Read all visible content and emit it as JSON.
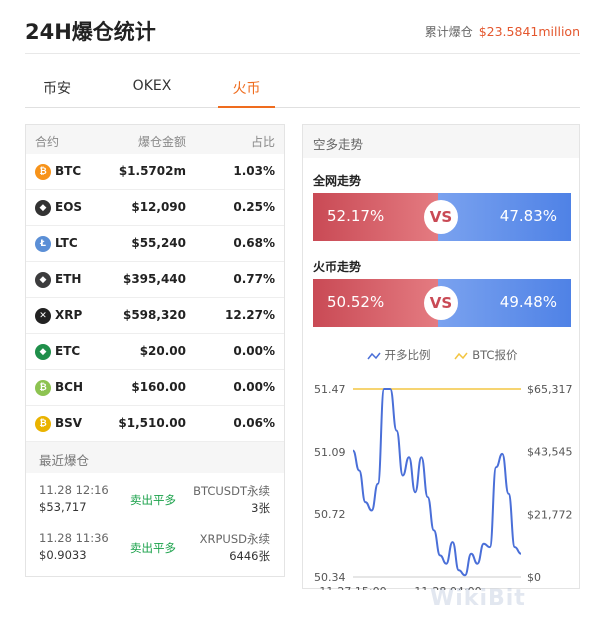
{
  "header": {
    "title": "24H爆仓统计",
    "total_label": "累计爆仓",
    "total_value": "$23.5841million"
  },
  "tabs": [
    {
      "label": "币安"
    },
    {
      "label": "OKEX"
    },
    {
      "label": "火币"
    }
  ],
  "active_tab": "火币",
  "table": {
    "columns": [
      "合约",
      "爆仓金额",
      "占比"
    ],
    "rows": [
      {
        "coin": "BTC",
        "amount": "$1.5702m",
        "ratio": "1.03%",
        "icon": "bitcoin-icon",
        "color": "#f7931a",
        "glyph": "₿"
      },
      {
        "coin": "EOS",
        "amount": "$12,090",
        "ratio": "0.25%",
        "icon": "eos-icon",
        "color": "#333333",
        "glyph": "◆"
      },
      {
        "coin": "LTC",
        "amount": "$55,240",
        "ratio": "0.68%",
        "icon": "litecoin-icon",
        "color": "#5b8fd6",
        "glyph": "Ł"
      },
      {
        "coin": "ETH",
        "amount": "$395,440",
        "ratio": "0.77%",
        "icon": "ethereum-icon",
        "color": "#3c3c3d",
        "glyph": "◆"
      },
      {
        "coin": "XRP",
        "amount": "$598,320",
        "ratio": "12.27%",
        "icon": "xrp-icon",
        "color": "#222222",
        "glyph": "✕"
      },
      {
        "coin": "ETC",
        "amount": "$20.00",
        "ratio": "0.00%",
        "icon": "ethereum-classic-icon",
        "color": "#1f8f4a",
        "glyph": "◆"
      },
      {
        "coin": "BCH",
        "amount": "$160.00",
        "ratio": "0.00%",
        "icon": "bitcoin-cash-icon",
        "color": "#8dc351",
        "glyph": "₿"
      },
      {
        "coin": "BSV",
        "amount": "$1,510.00",
        "ratio": "0.06%",
        "icon": "bitcoin-sv-icon",
        "color": "#eab300",
        "glyph": "₿"
      }
    ]
  },
  "recent": {
    "title": "最近爆仓",
    "items": [
      {
        "time": "11.28 12:16",
        "price": "$53,717",
        "action": "卖出平多",
        "pair": "BTCUSDT永续",
        "qty": "3张"
      },
      {
        "time": "11.28 11:36",
        "price": "$0.9033",
        "action": "卖出平多",
        "pair": "XRPUSD永续",
        "qty": "6446张"
      }
    ]
  },
  "trend": {
    "title": "空多走势",
    "network": {
      "label": "全网走势",
      "long": "52.17%",
      "short": "47.83%",
      "vs": "VS"
    },
    "huobi": {
      "label": "火币走势",
      "long": "50.52%",
      "short": "49.48%",
      "vs": "VS"
    }
  },
  "colors": {
    "accent": "#ef6c1e",
    "long": "#c94a55",
    "short": "#4f82e6",
    "ratio_line": "#4a6fd8",
    "btc_line": "#f3c542",
    "green": "#1aa14a"
  },
  "chart_data": {
    "type": "line",
    "legend": [
      "开多比例",
      "BTC报价"
    ],
    "left_axis": {
      "ticks": [
        "51.47",
        "51.09",
        "50.72",
        "50.34"
      ],
      "ylim": [
        50.34,
        51.47
      ]
    },
    "right_axis": {
      "ticks": [
        "$65,317",
        "$43,545",
        "$21,772",
        "$0"
      ],
      "ylim": [
        0,
        65317
      ]
    },
    "x_ticks": [
      "11-27 15:00",
      "11-28 04:00"
    ],
    "series": [
      {
        "name": "开多比例",
        "values": [
          51.1,
          50.98,
          50.79,
          50.74,
          50.9,
          51.47,
          51.47,
          51.22,
          50.95,
          51.06,
          50.85,
          51.06,
          50.82,
          50.62,
          50.47,
          50.42,
          50.55,
          50.38,
          50.35,
          50.48,
          50.42,
          50.54,
          50.52,
          51.0,
          51.08,
          50.84,
          50.52,
          50.48
        ]
      },
      {
        "name": "BTC报价",
        "values": [
          65317,
          65317,
          65317,
          65317,
          65317,
          65317,
          65317,
          65317,
          65317,
          65317,
          65317,
          65317,
          65317,
          65317,
          65317,
          65317,
          65317,
          65317,
          65317,
          65317,
          65317,
          65317,
          65317,
          65317,
          65317,
          65317,
          65317,
          65317
        ]
      }
    ]
  },
  "watermark": "WikiBit"
}
